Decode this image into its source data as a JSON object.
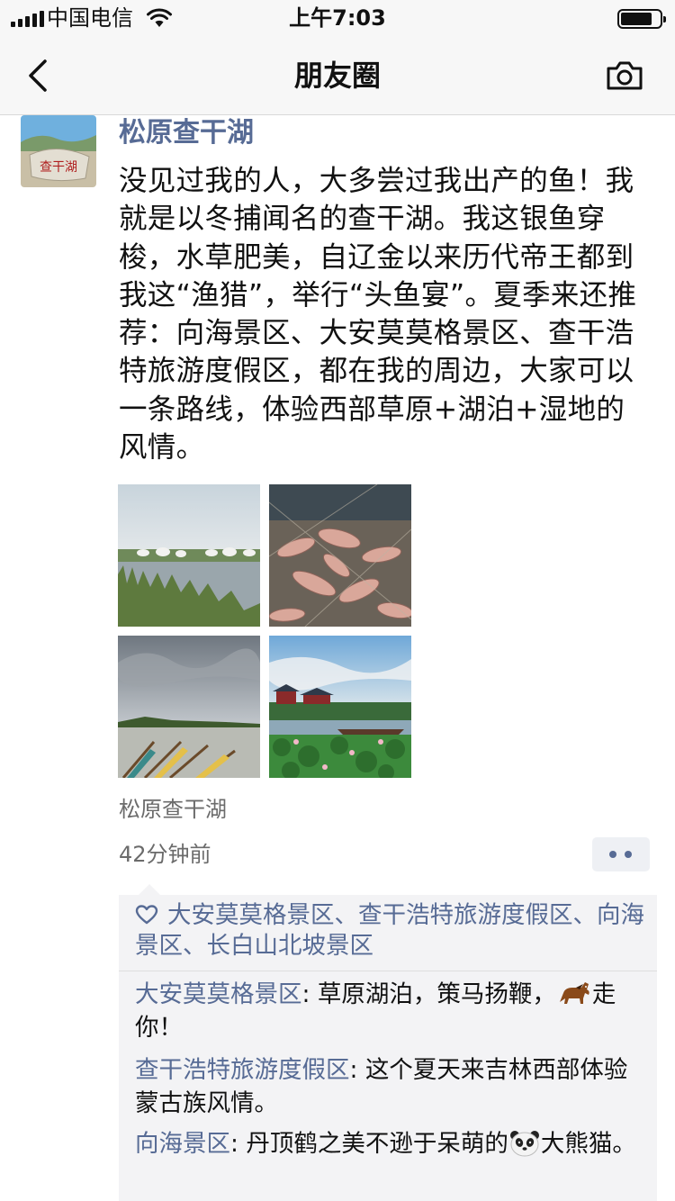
{
  "status_bar": {
    "carrier": "中国电信",
    "time": "上午7:03",
    "signal_icon": "signal-bars-icon",
    "wifi_icon": "wifi-icon",
    "battery_icon": "battery-icon"
  },
  "nav": {
    "back_icon": "chevron-left-icon",
    "title": "朋友圈",
    "camera_icon": "camera-icon"
  },
  "post": {
    "author": "松原查干湖",
    "avatar_caption": "查干湖",
    "text": "没见过我的人，大多尝过我出产的鱼！我就是以冬捕闻名的查干湖。我这银鱼穿梭，水草肥美，自辽金以来历代帝王都到我这“渔猎”，举行“头鱼宴”。夏季来还推荐：向海景区、大安莫莫格景区、查干浩特旅游度假区，都在我的周边，大家可以一条路线，体验西部草原+湖泊+湿地的风情。",
    "photos": [
      {
        "subject": "yurts-by-lake"
      },
      {
        "subject": "fish-in-net"
      },
      {
        "subject": "boats-on-shore"
      },
      {
        "subject": "lotus-pond-temple"
      }
    ],
    "location": "松原查干湖",
    "time_ago": "42分钟前",
    "more_icon": "two-dots-icon"
  },
  "interactions": {
    "like_icon": "heart-outline-icon",
    "likes": "大安莫莫格景区、查干浩特旅游度假区、向海景区、长白山北坡景区",
    "comments": [
      {
        "name": "大安莫莫格景区",
        "sep": ": ",
        "text_before": "草原湖泊，策马扬鞭，",
        "emoji": "horse-emoji",
        "text_after": "走你！"
      },
      {
        "name": "查干浩特旅游度假区",
        "sep": ": ",
        "text_before": "这个夏天来吉林西部体验蒙古族风情。",
        "emoji": "",
        "text_after": ""
      },
      {
        "name": "向海景区",
        "sep": ": ",
        "text_before": "丹顶鹤之美不逊于呆萌的",
        "emoji": "panda-emoji",
        "text_after": "大熊猫。"
      }
    ]
  },
  "colors": {
    "link_blue": "#576b95",
    "bar_background": "#f7f7f7",
    "comment_background": "#f3f3f5",
    "meta_gray": "#6b6b6b"
  }
}
